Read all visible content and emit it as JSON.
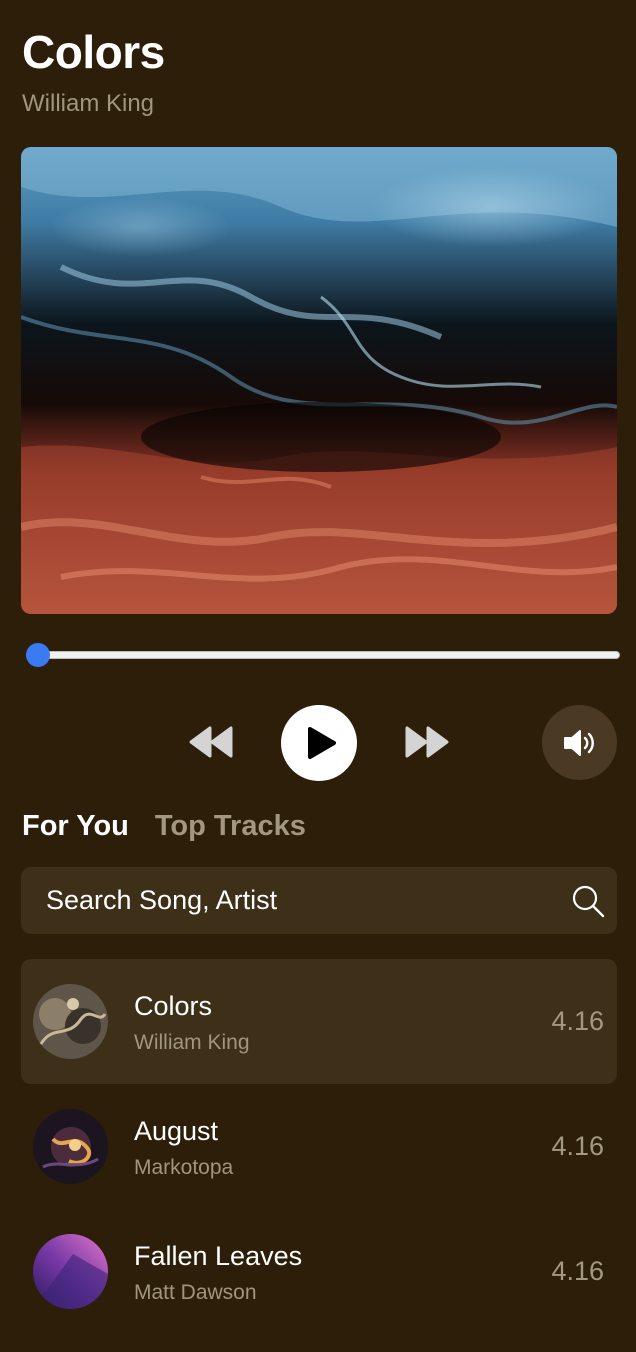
{
  "now_playing": {
    "title": "Colors",
    "artist": "William King",
    "progress": 0.0
  },
  "controls": {
    "rewind_icon": "rewind-icon",
    "play_icon": "play-icon",
    "forward_icon": "fast-forward-icon",
    "volume_icon": "speaker-volume-icon"
  },
  "tabs": [
    {
      "label": "For You",
      "active": true
    },
    {
      "label": "Top Tracks",
      "active": false
    }
  ],
  "search": {
    "placeholder": "Search Song, Artist",
    "icon": "search-icon"
  },
  "tracks": [
    {
      "title": "Colors",
      "artist": "William King",
      "duration": "4.16",
      "selected": true
    },
    {
      "title": "August",
      "artist": "Markotopa",
      "duration": "4.16",
      "selected": false
    },
    {
      "title": "Fallen Leaves",
      "artist": "Matt Dawson",
      "duration": "4.16",
      "selected": false
    }
  ],
  "colors": {
    "background": "#2d1e09",
    "panel": "#3e2f19",
    "accent": "#3a7bf4",
    "muted_text": "#a09580"
  }
}
